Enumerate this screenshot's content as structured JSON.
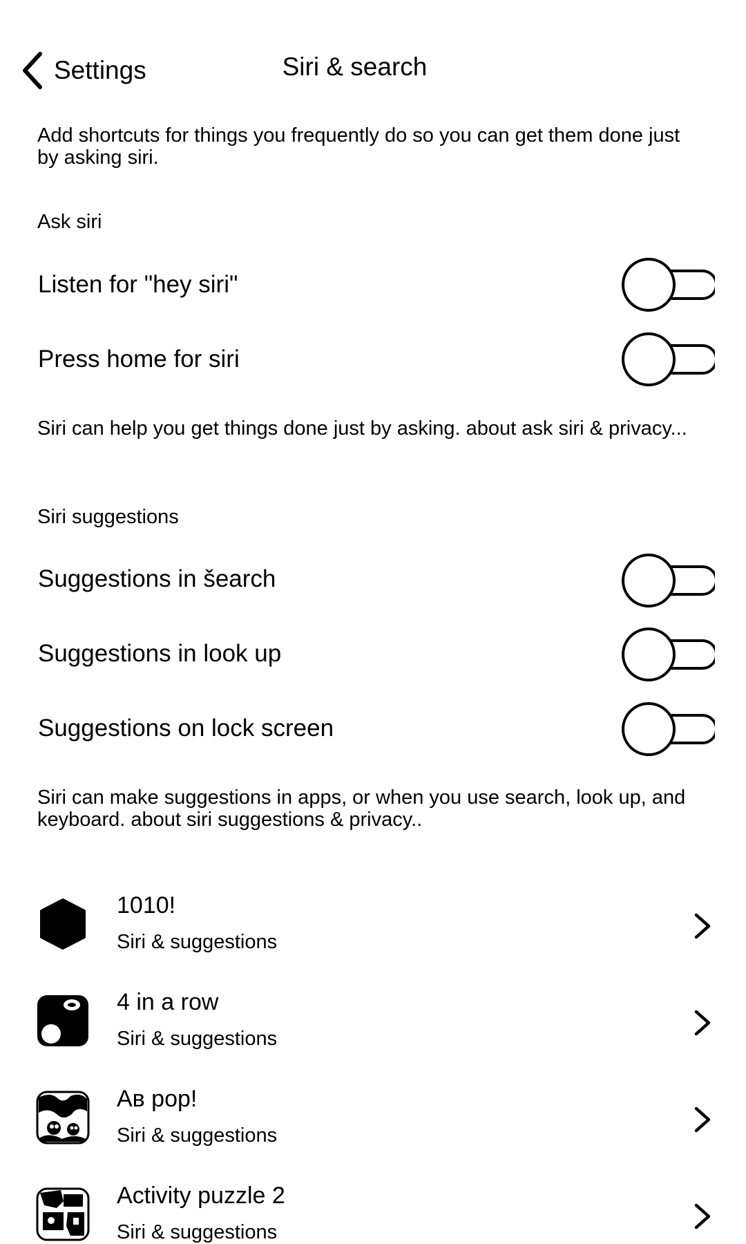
{
  "header": {
    "back_label": "Settings",
    "title": "Siri & search"
  },
  "intro_text": "Add shortcuts for things you frequently do so you can get them done just by asking siri.",
  "ask_siri": {
    "header": "Ask siri",
    "items": [
      {
        "label": "Listen for \"hey siri\"",
        "on": false
      },
      {
        "label": "Press home for siri",
        "on": false
      }
    ],
    "footer": "Siri can help you get things done just by asking. about ask siri & privacy..."
  },
  "siri_suggestions": {
    "header": "Siri suggestions",
    "items": [
      {
        "label": "Suggestions in šearch",
        "on": false
      },
      {
        "label": "Suggestions in look up",
        "on": false
      },
      {
        "label": "Suggestions on lock screen",
        "on": false
      }
    ],
    "footer": "Siri can make suggestions in apps, or when you use search, look up, and keyboard. about siri suggestions & privacy.."
  },
  "apps": [
    {
      "name": "1010!",
      "subtitle": "Siri & suggestions",
      "icon": "hexagon-app-icon"
    },
    {
      "name": "4 in a row",
      "subtitle": "Siri & suggestions",
      "icon": "four-in-a-row-app-icon"
    },
    {
      "name": "Aв pop!",
      "subtitle": "Siri & suggestions",
      "icon": "ab-pop-app-icon"
    },
    {
      "name": "Activity puzzle 2",
      "subtitle": "Siri & suggestions",
      "icon": "activity-puzzle-app-icon"
    }
  ]
}
